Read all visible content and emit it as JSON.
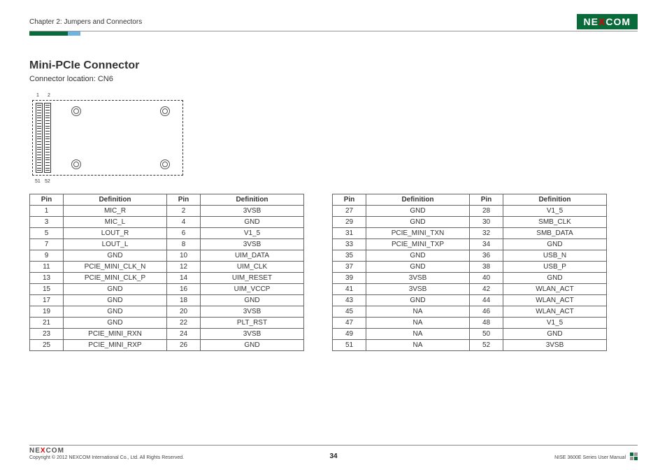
{
  "header": {
    "chapter": "Chapter 2: Jumpers and Connectors",
    "logo_pre": "NE",
    "logo_x": "X",
    "logo_post": "COM"
  },
  "title": "Mini-PCIe Connector",
  "subtitle": "Connector location: CN6",
  "diagram_labels": {
    "top1": "1",
    "top2": "2",
    "bot1": "51",
    "bot2": "52"
  },
  "table_headers": {
    "pin": "Pin",
    "def": "Definition"
  },
  "table1": [
    {
      "p1": "1",
      "d1": "MIC_R",
      "p2": "2",
      "d2": "3VSB"
    },
    {
      "p1": "3",
      "d1": "MIC_L",
      "p2": "4",
      "d2": "GND"
    },
    {
      "p1": "5",
      "d1": "LOUT_R",
      "p2": "6",
      "d2": "V1_5"
    },
    {
      "p1": "7",
      "d1": "LOUT_L",
      "p2": "8",
      "d2": "3VSB"
    },
    {
      "p1": "9",
      "d1": "GND",
      "p2": "10",
      "d2": "UIM_DATA"
    },
    {
      "p1": "11",
      "d1": "PCIE_MINI_CLK_N",
      "p2": "12",
      "d2": "UIM_CLK"
    },
    {
      "p1": "13",
      "d1": "PCIE_MINI_CLK_P",
      "p2": "14",
      "d2": "UIM_RESET"
    },
    {
      "p1": "15",
      "d1": "GND",
      "p2": "16",
      "d2": "UIM_VCCP"
    },
    {
      "p1": "17",
      "d1": "GND",
      "p2": "18",
      "d2": "GND"
    },
    {
      "p1": "19",
      "d1": "GND",
      "p2": "20",
      "d2": "3VSB"
    },
    {
      "p1": "21",
      "d1": "GND",
      "p2": "22",
      "d2": "PLT_RST"
    },
    {
      "p1": "23",
      "d1": "PCIE_MINI_RXN",
      "p2": "24",
      "d2": "3VSB"
    },
    {
      "p1": "25",
      "d1": "PCIE_MINI_RXP",
      "p2": "26",
      "d2": "GND"
    }
  ],
  "table2": [
    {
      "p1": "27",
      "d1": "GND",
      "p2": "28",
      "d2": "V1_5"
    },
    {
      "p1": "29",
      "d1": "GND",
      "p2": "30",
      "d2": "SMB_CLK"
    },
    {
      "p1": "31",
      "d1": "PCIE_MINI_TXN",
      "p2": "32",
      "d2": "SMB_DATA"
    },
    {
      "p1": "33",
      "d1": "PCIE_MINI_TXP",
      "p2": "34",
      "d2": "GND"
    },
    {
      "p1": "35",
      "d1": "GND",
      "p2": "36",
      "d2": "USB_N"
    },
    {
      "p1": "37",
      "d1": "GND",
      "p2": "38",
      "d2": "USB_P"
    },
    {
      "p1": "39",
      "d1": "3VSB",
      "p2": "40",
      "d2": "GND"
    },
    {
      "p1": "41",
      "d1": "3VSB",
      "p2": "42",
      "d2": "WLAN_ACT"
    },
    {
      "p1": "43",
      "d1": "GND",
      "p2": "44",
      "d2": "WLAN_ACT"
    },
    {
      "p1": "45",
      "d1": "NA",
      "p2": "46",
      "d2": "WLAN_ACT"
    },
    {
      "p1": "47",
      "d1": "NA",
      "p2": "48",
      "d2": "V1_5"
    },
    {
      "p1": "49",
      "d1": "NA",
      "p2": "50",
      "d2": "GND"
    },
    {
      "p1": "51",
      "d1": "NA",
      "p2": "52",
      "d2": "3VSB"
    }
  ],
  "footer": {
    "logo_pre": "NE",
    "logo_x": "X",
    "logo_post": "COM",
    "copyright": "Copyright © 2012 NEXCOM International Co., Ltd. All Rights Reserved.",
    "page": "34",
    "doc": "NISE 3600E Series User Manual"
  }
}
